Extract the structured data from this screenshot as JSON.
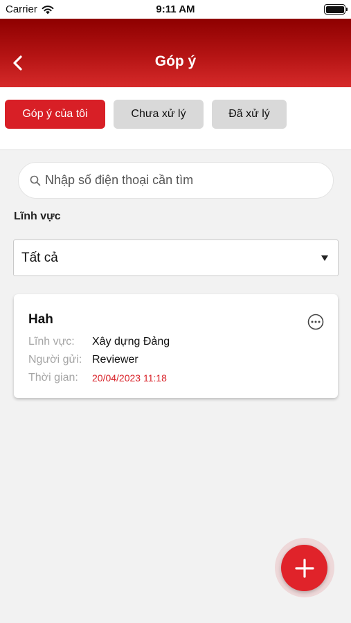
{
  "status_bar": {
    "carrier": "Carrier",
    "time": "9:11 AM"
  },
  "header": {
    "title": "Góp ý"
  },
  "tabs": [
    {
      "label": "Góp ý của tôi",
      "active": true
    },
    {
      "label": "Chưa xử lý",
      "active": false
    },
    {
      "label": "Đã xử lý",
      "active": false
    }
  ],
  "search": {
    "placeholder": "Nhập số điện thoại cần tìm",
    "value": ""
  },
  "filter": {
    "label": "Lĩnh vực",
    "selected": "Tất cả"
  },
  "feedback_list": [
    {
      "title": "Hah",
      "field_key": "Lĩnh vực:",
      "field_value": "Xây dựng Đảng",
      "sender_key": "Người gửi:",
      "sender_value": "Reviewer",
      "time_key": "Thời gian:",
      "time_value": "20/04/2023 11:18"
    }
  ],
  "icons": {
    "back": "chevron-left-icon",
    "search": "search-icon",
    "more": "more-horizontal-icon",
    "add": "plus-icon",
    "wifi": "wifi-icon",
    "battery": "battery-icon"
  },
  "colors": {
    "brand_red": "#d81f26",
    "header_dark": "#8e0000",
    "tab_inactive": "#d9d9d9",
    "background": "#f2f2f2"
  }
}
